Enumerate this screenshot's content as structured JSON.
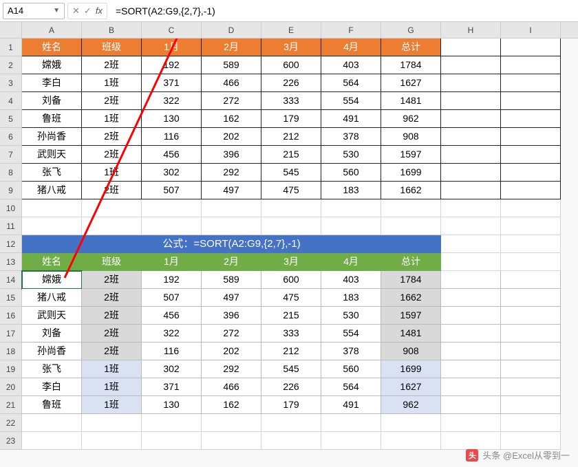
{
  "name_box": "A14",
  "formula": "=SORT(A2:G9,{2,7},-1)",
  "columns": [
    "A",
    "B",
    "C",
    "D",
    "E",
    "F",
    "G",
    "H",
    "I"
  ],
  "rows": [
    1,
    2,
    3,
    4,
    5,
    6,
    7,
    8,
    9,
    10,
    11,
    12,
    13,
    14,
    15,
    16,
    17,
    18,
    19,
    20,
    21,
    22,
    23
  ],
  "table1_header": [
    "姓名",
    "班级",
    "1月",
    "2月",
    "3月",
    "4月",
    "总计"
  ],
  "table1": [
    [
      "嫦娥",
      "2班",
      "192",
      "589",
      "600",
      "403",
      "1784"
    ],
    [
      "李白",
      "1班",
      "371",
      "466",
      "226",
      "564",
      "1627"
    ],
    [
      "刘备",
      "2班",
      "322",
      "272",
      "333",
      "554",
      "1481"
    ],
    [
      "鲁班",
      "1班",
      "130",
      "162",
      "179",
      "491",
      "962"
    ],
    [
      "孙尚香",
      "2班",
      "116",
      "202",
      "212",
      "378",
      "908"
    ],
    [
      "武则天",
      "2班",
      "456",
      "396",
      "215",
      "530",
      "1597"
    ],
    [
      "张飞",
      "1班",
      "302",
      "292",
      "545",
      "560",
      "1699"
    ],
    [
      "猪八戒",
      "2班",
      "507",
      "497",
      "475",
      "183",
      "1662"
    ]
  ],
  "formula_banner": "公式：=SORT(A2:G9,{2,7},-1)",
  "table2_header": [
    "姓名",
    "班级",
    "1月",
    "2月",
    "3月",
    "4月",
    "总计"
  ],
  "table2": [
    {
      "cells": [
        "嫦娥",
        "2班",
        "192",
        "589",
        "600",
        "403",
        "1784"
      ],
      "class": "grey"
    },
    {
      "cells": [
        "猪八戒",
        "2班",
        "507",
        "497",
        "475",
        "183",
        "1662"
      ],
      "class": "grey"
    },
    {
      "cells": [
        "武则天",
        "2班",
        "456",
        "396",
        "215",
        "530",
        "1597"
      ],
      "class": "grey"
    },
    {
      "cells": [
        "刘备",
        "2班",
        "322",
        "272",
        "333",
        "554",
        "1481"
      ],
      "class": "grey"
    },
    {
      "cells": [
        "孙尚香",
        "2班",
        "116",
        "202",
        "212",
        "378",
        "908"
      ],
      "class": "grey"
    },
    {
      "cells": [
        "张飞",
        "1班",
        "302",
        "292",
        "545",
        "560",
        "1699"
      ],
      "class": "blue"
    },
    {
      "cells": [
        "李白",
        "1班",
        "371",
        "466",
        "226",
        "564",
        "1627"
      ],
      "class": "blue"
    },
    {
      "cells": [
        "鲁班",
        "1班",
        "130",
        "162",
        "179",
        "491",
        "962"
      ],
      "class": "blue"
    }
  ],
  "watermark": "头条 @Excel从零到一",
  "chart_data": {
    "type": "table",
    "title": "SORT formula result sorted by columns {2,7} descending",
    "columns": [
      "姓名",
      "班级",
      "1月",
      "2月",
      "3月",
      "4月",
      "总计"
    ],
    "source_rows": [
      [
        "嫦娥",
        "2班",
        192,
        589,
        600,
        403,
        1784
      ],
      [
        "李白",
        "1班",
        371,
        466,
        226,
        564,
        1627
      ],
      [
        "刘备",
        "2班",
        322,
        272,
        333,
        554,
        1481
      ],
      [
        "鲁班",
        "1班",
        130,
        162,
        179,
        491,
        962
      ],
      [
        "孙尚香",
        "2班",
        116,
        202,
        212,
        378,
        908
      ],
      [
        "武则天",
        "2班",
        456,
        396,
        215,
        530,
        1597
      ],
      [
        "张飞",
        "1班",
        302,
        292,
        545,
        560,
        1699
      ],
      [
        "猪八戒",
        "2班",
        507,
        497,
        475,
        183,
        1662
      ]
    ],
    "sorted_rows": [
      [
        "嫦娥",
        "2班",
        192,
        589,
        600,
        403,
        1784
      ],
      [
        "猪八戒",
        "2班",
        507,
        497,
        475,
        183,
        1662
      ],
      [
        "武则天",
        "2班",
        456,
        396,
        215,
        530,
        1597
      ],
      [
        "刘备",
        "2班",
        322,
        272,
        333,
        554,
        1481
      ],
      [
        "孙尚香",
        "2班",
        116,
        202,
        212,
        378,
        908
      ],
      [
        "张飞",
        "1班",
        302,
        292,
        545,
        560,
        1699
      ],
      [
        "李白",
        "1班",
        371,
        466,
        226,
        564,
        1627
      ],
      [
        "鲁班",
        "1班",
        130,
        162,
        179,
        491,
        962
      ]
    ]
  }
}
